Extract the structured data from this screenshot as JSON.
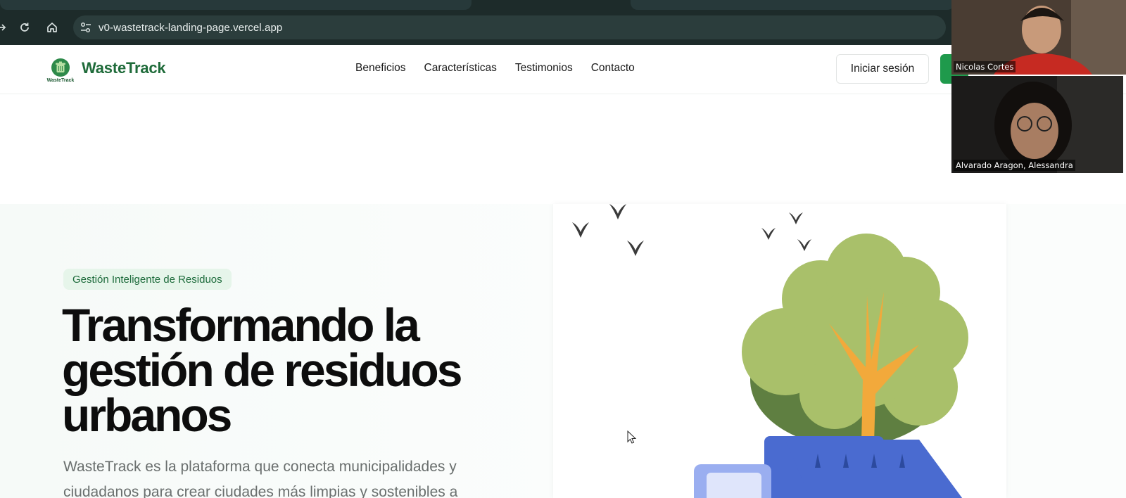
{
  "browser": {
    "url": "v0-wastetrack-landing-page.vercel.app",
    "icons": [
      "forward-icon",
      "reload-icon",
      "home-icon",
      "site-settings-icon"
    ]
  },
  "header": {
    "logo_caption": "WasteTrack",
    "brand": "WasteTrack",
    "nav": [
      "Beneficios",
      "Características",
      "Testimonios",
      "Contacto"
    ],
    "login_label": "Iniciar sesión",
    "accent_color": "#1f9a4c"
  },
  "hero": {
    "badge": "Gestión Inteligente de Residuos",
    "title": "Transformando la gestión de residuos urbanos",
    "description": "WasteTrack es la plataforma que conecta municipalidades y ciudadanos para crear ciudades más limpias y sostenibles a"
  },
  "video_call": {
    "participants": [
      {
        "name": "Nicolas Cortes"
      },
      {
        "name": "Alvarado Aragon, Alessandra"
      }
    ]
  }
}
